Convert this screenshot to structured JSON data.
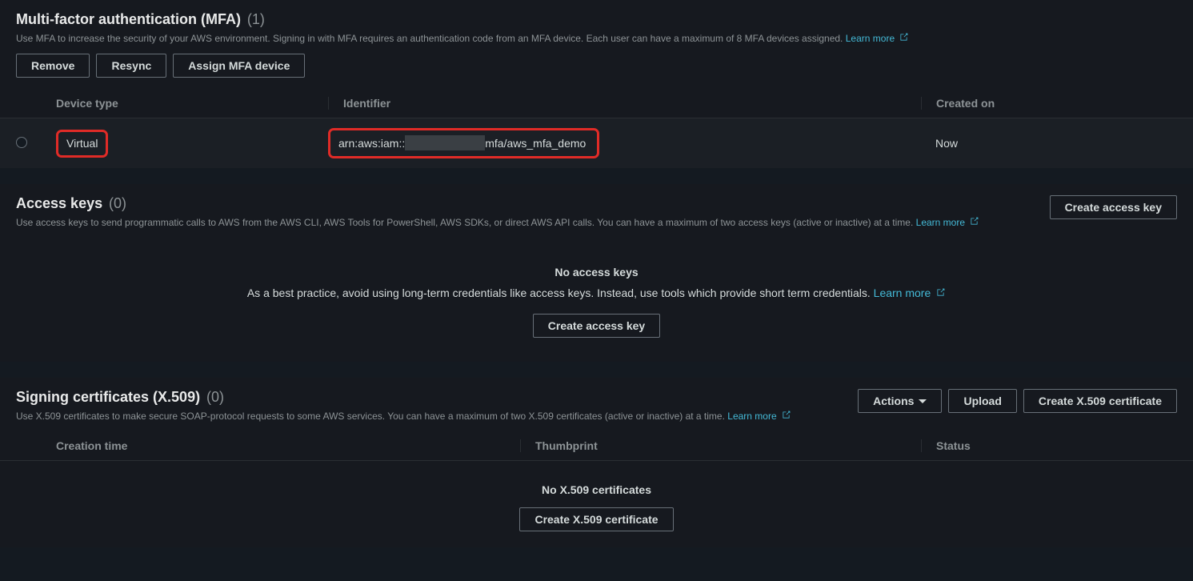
{
  "mfa": {
    "title": "Multi-factor authentication (MFA)",
    "count": "(1)",
    "desc": "Use MFA to increase the security of your AWS environment. Signing in with MFA requires an authentication code from an MFA device. Each user can have a maximum of 8 MFA devices assigned.",
    "learn_more": "Learn more",
    "buttons": {
      "remove": "Remove",
      "resync": "Resync",
      "assign": "Assign MFA device"
    },
    "columns": {
      "type": "Device type",
      "identifier": "Identifier",
      "created": "Created on"
    },
    "row": {
      "type": "Virtual",
      "id_prefix": "arn:aws:iam::",
      "id_suffix": "mfa/aws_mfa_demo",
      "created": "Now"
    }
  },
  "access_keys": {
    "title": "Access keys",
    "count": "(0)",
    "desc": "Use access keys to send programmatic calls to AWS from the AWS CLI, AWS Tools for PowerShell, AWS SDKs, or direct AWS API calls. You can have a maximum of two access keys (active or inactive) at a time.",
    "learn_more": "Learn more",
    "create_btn": "Create access key",
    "empty_title": "No access keys",
    "empty_desc": "As a best practice, avoid using long-term credentials like access keys. Instead, use tools which provide short term credentials.",
    "empty_learn_more": "Learn more",
    "empty_btn": "Create access key"
  },
  "signing": {
    "title": "Signing certificates (X.509)",
    "count": "(0)",
    "desc": "Use X.509 certificates to make secure SOAP-protocol requests to some AWS services. You can have a maximum of two X.509 certificates (active or inactive) at a time.",
    "learn_more": "Learn more",
    "buttons": {
      "actions": "Actions",
      "upload": "Upload",
      "create": "Create X.509 certificate"
    },
    "columns": {
      "ctime": "Creation time",
      "thumb": "Thumbprint",
      "status": "Status"
    },
    "empty_title": "No X.509 certificates",
    "empty_btn": "Create X.509 certificate"
  }
}
